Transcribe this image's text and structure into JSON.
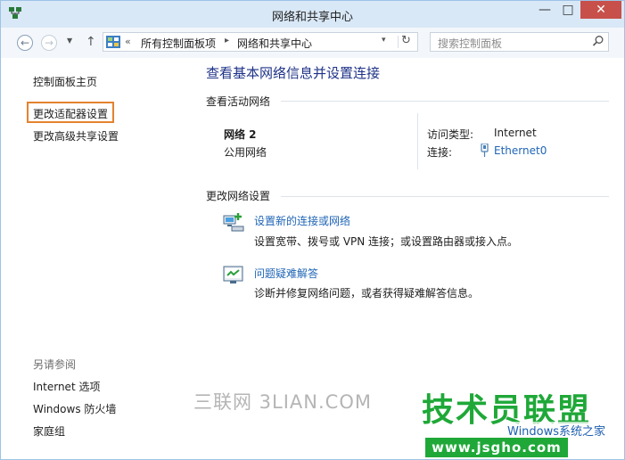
{
  "window": {
    "title": "网络和共享中心"
  },
  "titlebar": {
    "min": "—",
    "max": "□",
    "close": "✕"
  },
  "navbar": {
    "back": "←",
    "forward": "→",
    "recent": "▼",
    "up": "↑",
    "address": {
      "chevrons": "«",
      "crumb1": "所有控制面板项",
      "separator": "▸",
      "crumb2": "网络和共享中心",
      "dropdown": "▾",
      "refresh": "↻"
    },
    "search": {
      "placeholder": "搜索控制面板"
    }
  },
  "sidebar": {
    "home": "控制面板主页",
    "change_adapter": "更改适配器设置",
    "change_sharing": "更改高级共享设置",
    "see_also_header": "另请参阅",
    "see_also": [
      "Internet 选项",
      "Windows 防火墙",
      "家庭组"
    ]
  },
  "main": {
    "title": "查看基本网络信息并设置连接",
    "active_header": "查看活动网络",
    "network": {
      "name": "网络 2",
      "type": "公用网络",
      "access_label": "访问类型:",
      "access_value": "Internet",
      "conn_label": "连接:",
      "conn_value": "Ethernet0"
    },
    "change_header": "更改网络设置",
    "tasks": [
      {
        "link": "设置新的连接或网络",
        "desc": "设置宽带、拨号或 VPN 连接；或设置路由器或接入点。"
      },
      {
        "link": "问题疑难解答",
        "desc": "诊断并修复网络问题，或者获得疑难解答信息。"
      }
    ]
  },
  "watermark": {
    "text1": "三联网 3LIAN.COM",
    "logo_title": "技术员联盟",
    "logo_sub": "Windows系统之家",
    "logo_url": "www.jsgho.com"
  },
  "colors": {
    "accent_link": "#1f65b5",
    "title_blue": "#1e3287",
    "highlight": "#e4822e",
    "close_red": "#c7504a",
    "logo_green": "#1fa838"
  }
}
